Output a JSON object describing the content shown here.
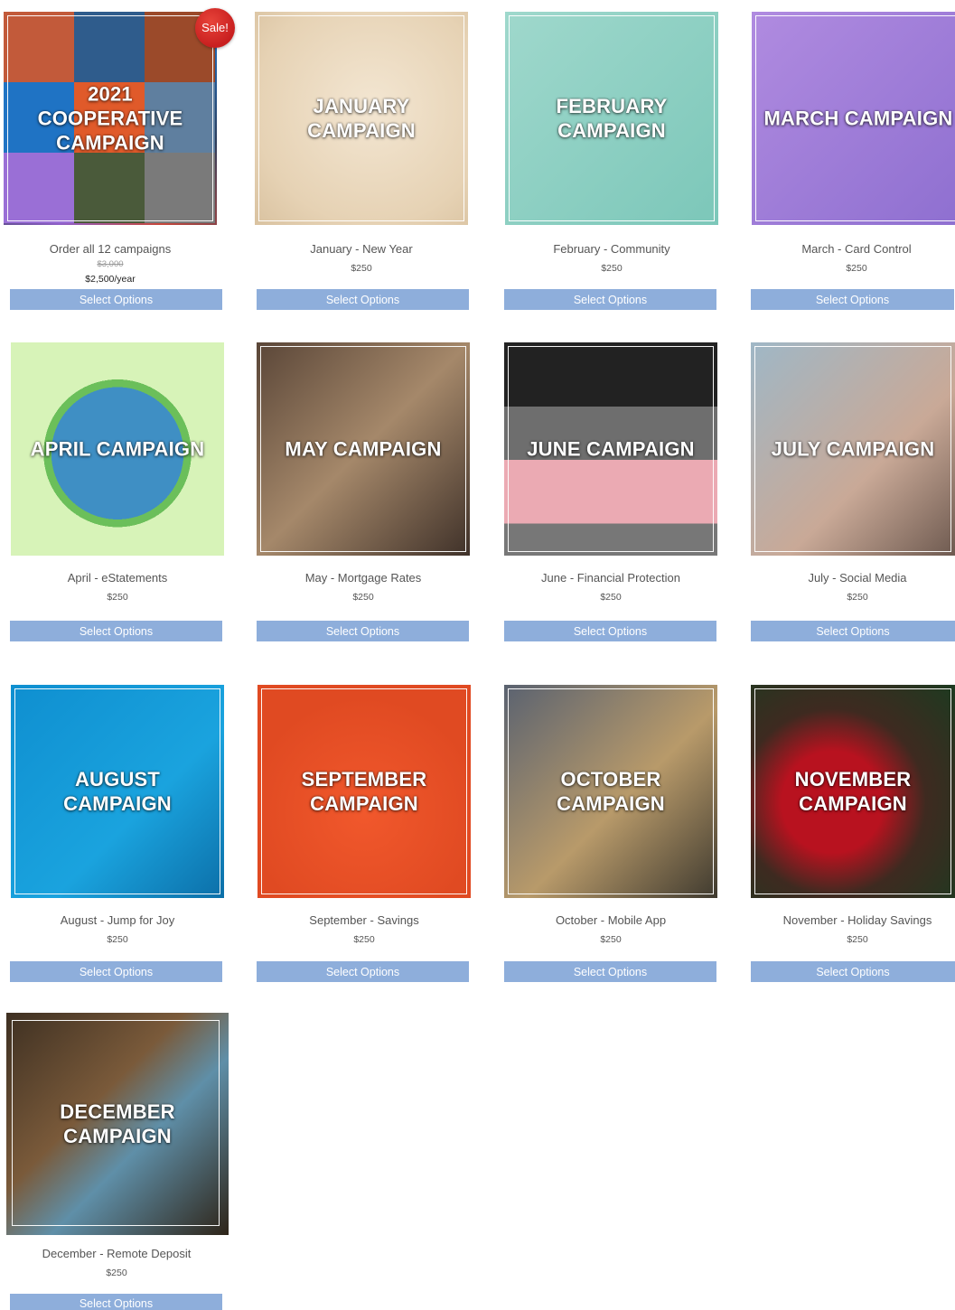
{
  "sale_badge": "Sale!",
  "button_label": "Select Options",
  "products": [
    {
      "id": "coop",
      "image_title": "2021 COOPERATIVE CAMPAIGN",
      "name": "Order all 12 campaigns",
      "old_price": "$3,000",
      "price": "$2,500/year",
      "on_sale": true
    },
    {
      "id": "jan",
      "image_title": "JANUARY CAMPAIGN",
      "name": "January - New Year",
      "price": "$250"
    },
    {
      "id": "feb",
      "image_title": "FEBRUARY CAMPAIGN",
      "name": "February - Community",
      "price": "$250"
    },
    {
      "id": "mar",
      "image_title": "MARCH CAMPAIGN",
      "name": "March - Card Control",
      "price": "$250"
    },
    {
      "id": "apr",
      "image_title": "APRIL CAMPAIGN",
      "name": "April - eStatements",
      "price": "$250"
    },
    {
      "id": "may",
      "image_title": "MAY CAMPAIGN",
      "name": "May - Mortgage Rates",
      "price": "$250"
    },
    {
      "id": "jun",
      "image_title": "JUNE CAMPAIGN",
      "name": "June - Financial Protection",
      "price": "$250"
    },
    {
      "id": "jul",
      "image_title": "JULY CAMPAIGN",
      "name": "July - Social Media",
      "price": "$250"
    },
    {
      "id": "aug",
      "image_title": "AUGUST CAMPAIGN",
      "name": "August - Jump for Joy",
      "price": "$250"
    },
    {
      "id": "sep",
      "image_title": "SEPTEMBER CAMPAIGN",
      "name": "September - Savings",
      "price": "$250"
    },
    {
      "id": "oct",
      "image_title": "OCTOBER CAMPAIGN",
      "name": "October - Mobile App",
      "price": "$250"
    },
    {
      "id": "nov",
      "image_title": "NOVEMBER CAMPAIGN",
      "name": "November -  Holiday Savings",
      "price": "$250"
    },
    {
      "id": "dec",
      "image_title": "DECEMBER CAMPAIGN",
      "name": "December - Remote Deposit",
      "price": "$250"
    }
  ]
}
